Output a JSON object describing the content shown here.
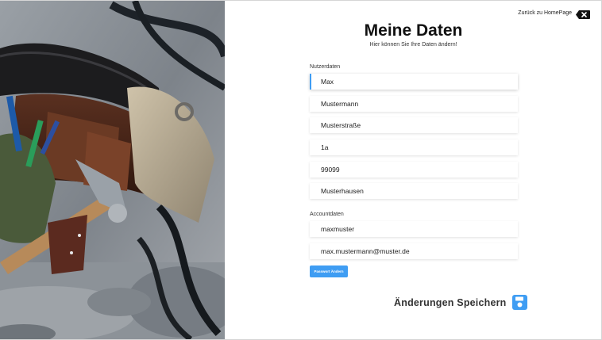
{
  "header": {
    "back_link_label": "Zurück zu HomePage",
    "title": "Meine Daten",
    "subtitle": "Hier können Sie Ihre Daten ändern!"
  },
  "user_section": {
    "label": "Nutzerdaten",
    "fields": [
      {
        "value": "Max"
      },
      {
        "value": "Mustermann"
      },
      {
        "value": "Musterstraße"
      },
      {
        "value": "1a"
      },
      {
        "value": "99099"
      },
      {
        "value": "Musterhausen"
      }
    ]
  },
  "account_section": {
    "label": "Accountdaten",
    "fields": [
      {
        "value": "maxmuster"
      },
      {
        "value": "max.mustermann@muster.de"
      }
    ],
    "password_button_label": "Passwort Ändern"
  },
  "save": {
    "label": "Änderungen Speichern",
    "icon": "floppy-disk-icon"
  },
  "photo": {
    "subject": "tool-belt-image"
  },
  "colors": {
    "accent": "#3f9df3",
    "text": "#222222",
    "background": "#ffffff"
  }
}
